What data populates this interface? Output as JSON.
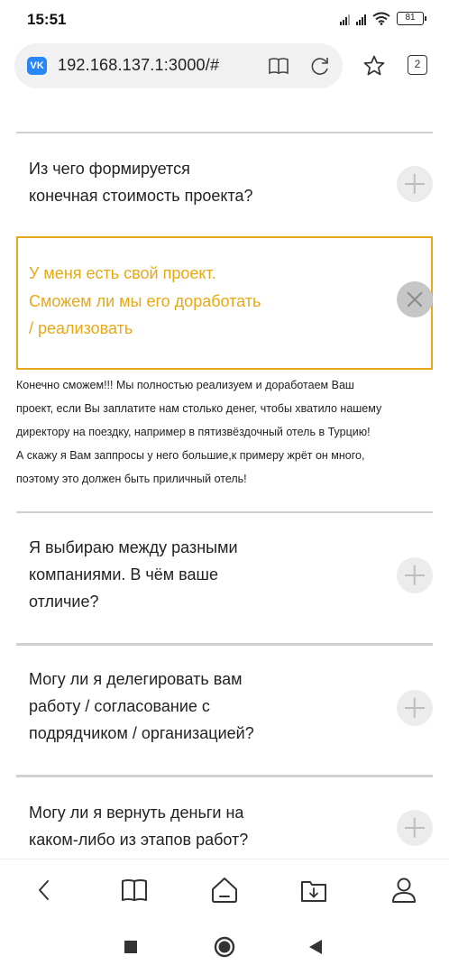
{
  "status_bar": {
    "time": "15:51",
    "battery": "81",
    "icons": [
      "signal-icon",
      "signal-icon",
      "wifi-icon",
      "battery-icon"
    ]
  },
  "browser": {
    "url": "192.168.137.1:3000/#",
    "site_logo": "VK",
    "tabs_count": "2",
    "icons": [
      "reader-mode-icon",
      "reload-icon",
      "bookmark-star-icon",
      "tabs-icon"
    ]
  },
  "faq": {
    "items": [
      {
        "question_lines": [
          "Из чего формируется",
          "конечная стоимость проекта?"
        ],
        "state": "collapsed"
      },
      {
        "question_lines": [
          "У меня есть свой проект.",
          "Сможем ли мы его доработать",
          "/ реализовать"
        ],
        "state": "expanded",
        "answer_lines": [
          "Конечно сможем!!! Мы полностью реализуем и доработаем Ваш",
          "проект, если Вы заплатите нам столько денег, чтобы хватило нашему",
          "директору на поездку, например в пятизвёздочный отель в Турцию!",
          "А скажу я Вам заппросы у него большие,к примеру жрёт он много,",
          "поэтому это должен быть приличный отель!"
        ]
      },
      {
        "question_lines": [
          "Я выбираю между разными",
          "компаниями. В чём ваше",
          "отличие?"
        ],
        "state": "collapsed"
      },
      {
        "question_lines": [
          "Могу ли я делегировать вам",
          "работу / согласование с",
          "подрядчиком / организацией?"
        ],
        "state": "collapsed"
      },
      {
        "question_lines": [
          "Могу ли я вернуть деньги на",
          "каком-либо из этапов работ?"
        ],
        "state": "collapsed"
      }
    ],
    "accent_color": "#e6a817"
  },
  "bottom_nav": {
    "icons": [
      "back-arrow-icon",
      "bookmarks-book-icon",
      "home-icon",
      "downloads-icon",
      "profile-icon"
    ]
  },
  "system_nav": {
    "icons": [
      "recents-square-icon",
      "home-circle-icon",
      "back-triangle-icon"
    ]
  }
}
